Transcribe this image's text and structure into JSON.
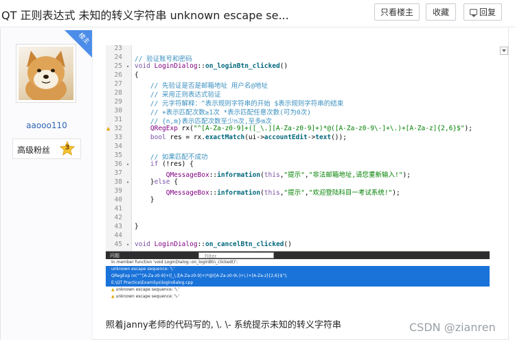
{
  "header": {
    "title": "QT 正则表达式 未知的转义字符串 unknown escape se...",
    "only_host_label": "只看楼主",
    "favorite_label": "收藏",
    "reply_label": "回复"
  },
  "author": {
    "badge": "楼主",
    "username": "aaooo110",
    "rank_label": "高级粉丝",
    "rank_level": "3"
  },
  "code": {
    "lines": [
      {
        "n": "23",
        "t": ""
      },
      {
        "n": "24",
        "t": "// 验证账号和密码"
      },
      {
        "n": "25",
        "t": "void LoginDialog::on_loginBtn_clicked()"
      },
      {
        "n": "26",
        "t": "{"
      },
      {
        "n": "27",
        "t": "    // 先验证是否是邮箱地址 用户名@地址"
      },
      {
        "n": "28",
        "t": "    // 采用正则表达式验证"
      },
      {
        "n": "29",
        "t": "    // 元字符解释：^表示规则字符串的开始 $表示规则字符串的结束"
      },
      {
        "n": "30",
        "t": "    // +表示匹配次数≥1次 *表示匹配任意次数(可为0次)"
      },
      {
        "n": "31",
        "t": "    // {n,m}表示匹配次数至少n次,至多m次"
      },
      {
        "n": "32",
        "t": "    QRegExp rx(\"^[A-Za-z0-9]+([_\\.][A-Za-z0-9]+)*@([A-Za-z0-9\\-]+\\.)+[A-Za-z]{2,6}$\");"
      },
      {
        "n": "33",
        "t": "    bool res = rx.exactMatch(ui->accountEdit->text());"
      },
      {
        "n": "34",
        "t": ""
      },
      {
        "n": "35",
        "t": "    // 如果匹配不成功"
      },
      {
        "n": "36",
        "t": "    if (!res) {"
      },
      {
        "n": "37",
        "t": "        QMessageBox::information(this,\"提示\",\"非法邮箱地址,请您重新输入!\");"
      },
      {
        "n": "38",
        "t": "    }else {"
      },
      {
        "n": "39",
        "t": "        QMessageBox::information(this,\"提示\",\"欢迎登陆科目一考试系统!\");"
      },
      {
        "n": "40",
        "t": "    }"
      },
      {
        "n": "41",
        "t": ""
      },
      {
        "n": "42",
        "t": ""
      },
      {
        "n": "43",
        "t": "}"
      },
      {
        "n": "44",
        "t": ""
      },
      {
        "n": "45",
        "t": "void LoginDialog::on_cancelBtn_clicked()"
      }
    ],
    "issues_tab": "问题",
    "issues_filter": "Filter",
    "issues_rows": [
      "In member function 'void LoginDialog::on_loginBtn_clicked()':",
      "unknown escape sequence: '\\.'",
      "    QRegExp rx(\"^[A-Za-z0-9]+([_\\.][A-Za-z0-9]+)*@([A-Za-z0-9\\-]+\\.)+[A-Za-z]{2,6}$\");",
      "E:\\QT Practice\\ExamSys\\logindialog.cpp",
      "unknown escape sequence: '\\.'",
      "unknown escape sequence: '\\-'"
    ]
  },
  "post": {
    "caption": "照着janny老师的代码写的, \\. \\- 系统提示未知的转义字符串"
  },
  "watermark": "CSDN @zianren"
}
